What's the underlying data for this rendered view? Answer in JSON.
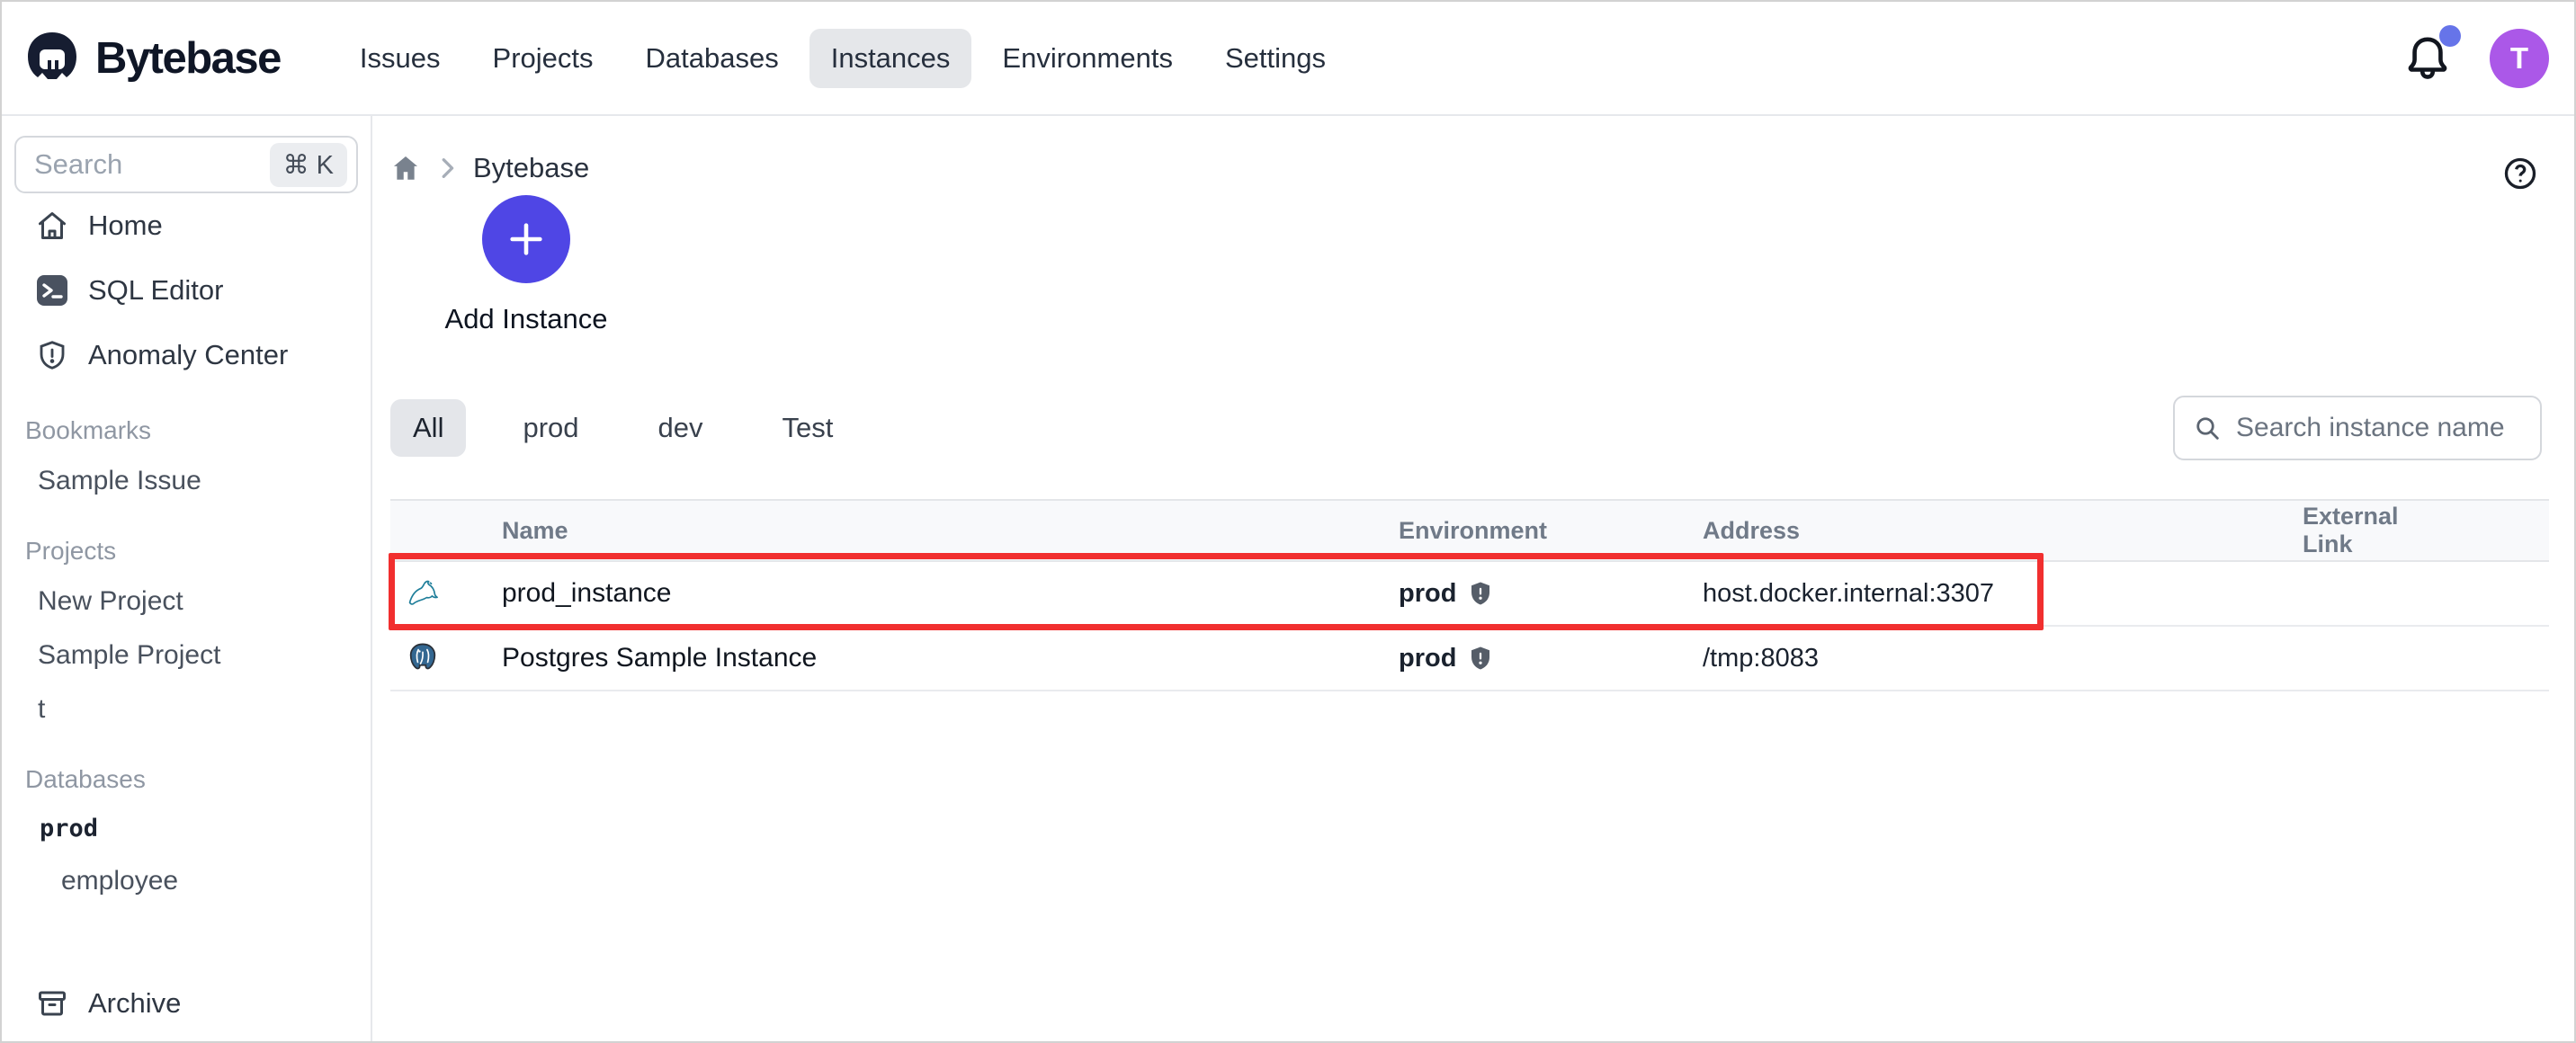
{
  "nav": {
    "brand": "Bytebase",
    "items": [
      {
        "label": "Issues",
        "active": false
      },
      {
        "label": "Projects",
        "active": false
      },
      {
        "label": "Databases",
        "active": false
      },
      {
        "label": "Instances",
        "active": true
      },
      {
        "label": "Environments",
        "active": false
      },
      {
        "label": "Settings",
        "active": false
      }
    ],
    "notifications": {
      "unread": true
    },
    "avatar_letter": "T"
  },
  "sidebar": {
    "search": {
      "placeholder": "Search",
      "shortcut": "⌘ K"
    },
    "items": [
      {
        "label": "Home",
        "icon": "home-icon"
      },
      {
        "label": "SQL Editor",
        "icon": "sql-editor-icon"
      },
      {
        "label": "Anomaly Center",
        "icon": "shield-alert-icon"
      }
    ],
    "sections": [
      {
        "label": "Bookmarks",
        "items": [
          {
            "label": "Sample Issue"
          }
        ]
      },
      {
        "label": "Projects",
        "items": [
          {
            "label": "New Project"
          },
          {
            "label": "Sample Project"
          },
          {
            "label": "t"
          }
        ]
      },
      {
        "label": "Databases",
        "items": [
          {
            "label": "prod"
          },
          {
            "label": "employee"
          }
        ]
      }
    ],
    "archive": {
      "label": "Archive",
      "icon": "archive-icon"
    }
  },
  "breadcrumb": {
    "root_icon": "home-icon",
    "current": "Bytebase"
  },
  "main": {
    "add_instance": {
      "label": "Add Instance",
      "icon": "plus-icon"
    },
    "filter_tabs": [
      {
        "label": "All",
        "active": true
      },
      {
        "label": "prod",
        "active": false
      },
      {
        "label": "dev",
        "active": false
      },
      {
        "label": "Test",
        "active": false
      }
    ],
    "search": {
      "placeholder": "Search instance name",
      "icon": "search-icon"
    },
    "table": {
      "columns": [
        "Name",
        "Environment",
        "Address",
        "External Link"
      ],
      "rows": [
        {
          "engine_icon": "mysql-icon",
          "name": "prod_instance",
          "environment": "prod",
          "env_icon": "shield-icon",
          "address": "host.docker.internal:3307",
          "external_link": "",
          "highlighted": true
        },
        {
          "engine_icon": "postgresql-icon",
          "name": "Postgres Sample Instance",
          "environment": "prod",
          "env_icon": "shield-icon",
          "address": "/tmp:8083",
          "external_link": "",
          "highlighted": false
        }
      ]
    },
    "annotation": {
      "type": "highlight-box",
      "color": "#f12f2f"
    }
  },
  "colors": {
    "accent_indigo": "#4f46e5",
    "avatar_purple": "#ab58e8",
    "notification_dot": "#6674e9",
    "active_pill_gray": "#e5e7ea",
    "highlight_red": "#f12f2f",
    "mysql_teal": "#1f7e9a",
    "postgres_blue": "#336791"
  }
}
